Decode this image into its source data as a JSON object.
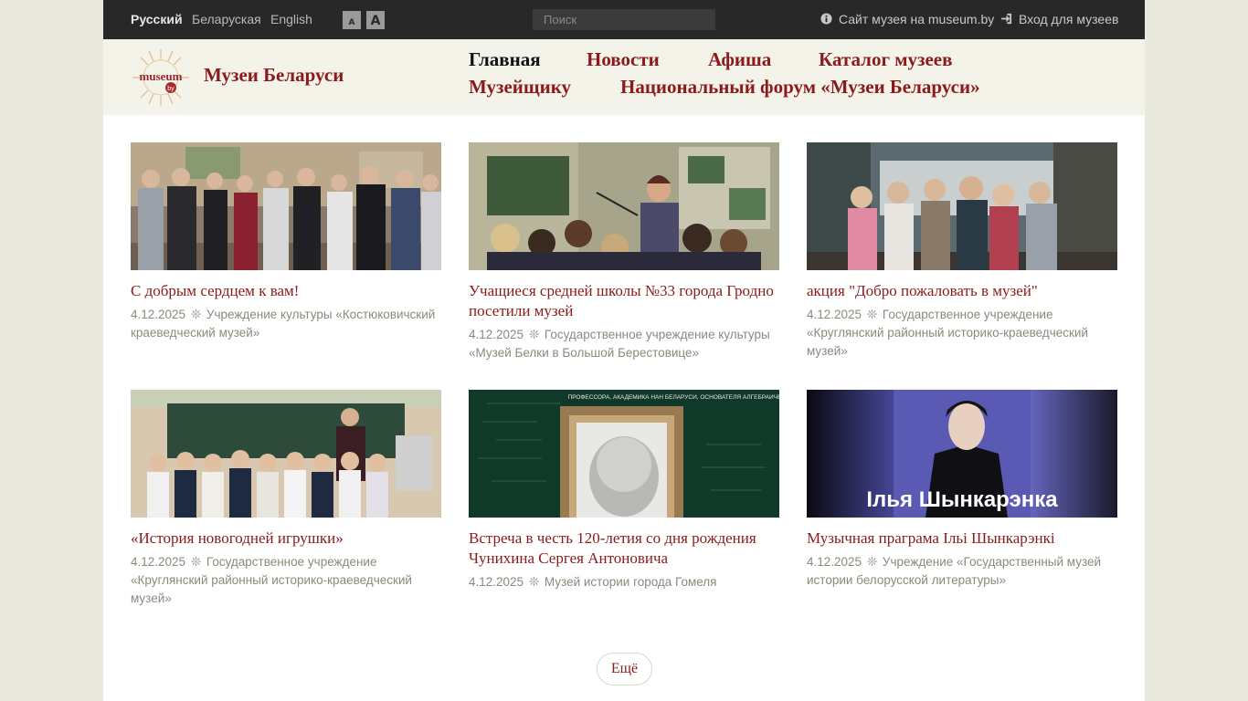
{
  "topbar": {
    "languages": [
      "Русский",
      "Беларуская",
      "English"
    ],
    "font_small": "A",
    "font_large": "A",
    "search_placeholder": "Поиск",
    "museum_site_link": "Сайт музея на museum.by",
    "museum_login_link": "Вход для музеев"
  },
  "header": {
    "logo_text": "museum",
    "logo_badge": "by",
    "site_name": "Музеи Беларуси",
    "nav": [
      "Главная",
      "Новости",
      "Афиша",
      "Каталог музеев",
      "Музейщику",
      "Национальный форум «Музеи Беларуси»"
    ]
  },
  "cards": [
    {
      "title": "С добрым сердцем к вам!",
      "date": "4.12.2025",
      "org": "Учреждение культуры «Костюковичский краеведческий музей»"
    },
    {
      "title": "Учащиеся средней школы №33 города Гродно посетили музей",
      "date": "4.12.2025",
      "org": "Государственное учреждение культуры «Музей Белки в Большой Берестовице»"
    },
    {
      "title": "акция \"Добро пожаловать в музей\"",
      "date": "4.12.2025",
      "org": "Государственное учреждение «Круглянский районный историко-краеведческий музей»"
    },
    {
      "title": "«История новогодней игрушки»",
      "date": "4.12.2025",
      "org": "Государственное учреждение «Круглянский районный историко-краеведческий музей»"
    },
    {
      "title": "Встреча в честь 120-летия со дня рождения Чунихина Сергея Антоновича",
      "date": "4.12.2025",
      "org": "Музей истории города Гомеля",
      "image_text": "ПРОФЕССОРА, АКАДЕМИКА НАН БЕЛАРУСИ, ОСНОВАТЕЛЯ АЛГЕБРАИЧЕСКОЙ ШКОЛЫ В ГОМЕЛЕ"
    },
    {
      "title": "Музычная праграма Ільі Шынкарэнкі",
      "date": "4.12.2025",
      "org": "Учреждение «Государственный музей истории белорусской литературы»",
      "image_text": "Ілья Шынкарэнка"
    }
  ],
  "more_button": "Ещё",
  "colors": {
    "accent": "#8b1a1a",
    "topbar": "#282828",
    "header": "#f3f3ea",
    "page_bg": "#e9e9de"
  }
}
